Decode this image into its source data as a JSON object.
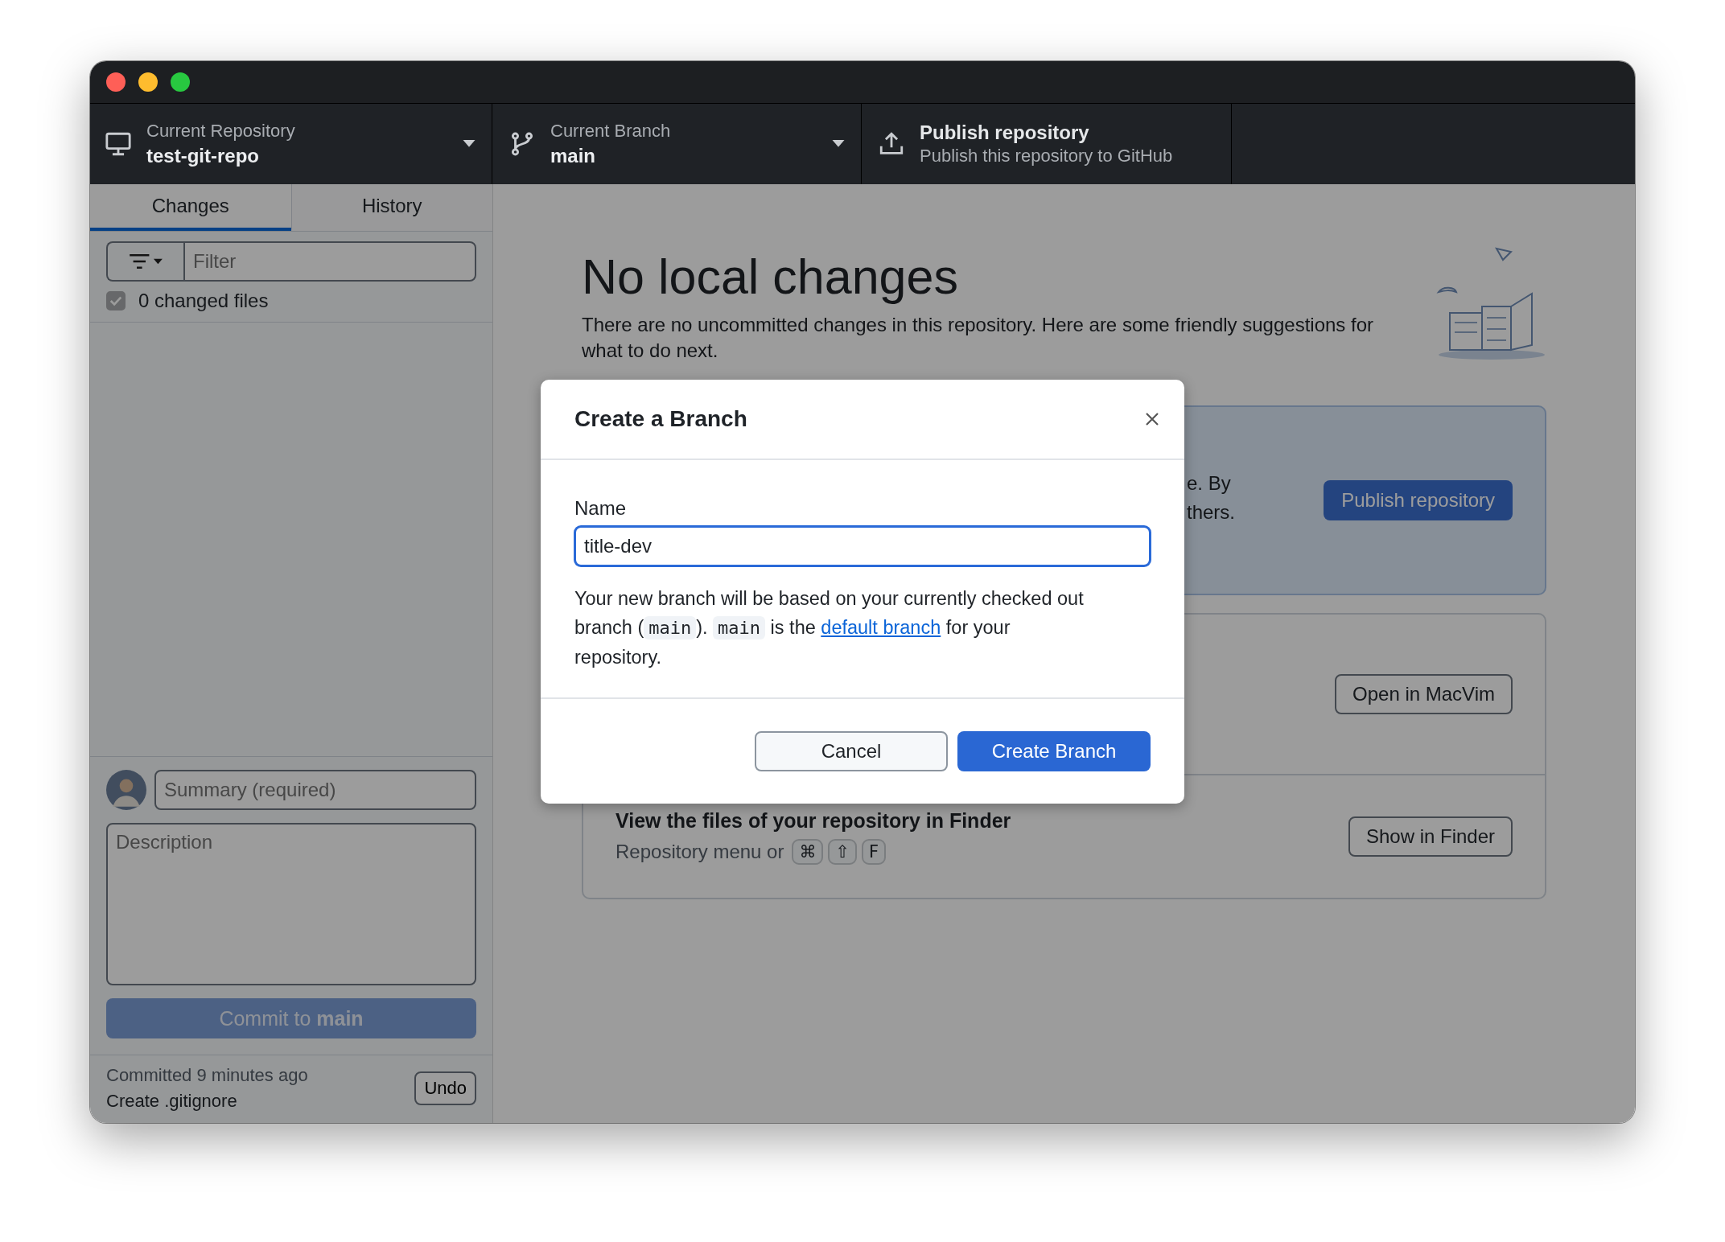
{
  "toolbar": [
    {
      "kind": "repository",
      "label": "Current Repository",
      "value": "test-git-repo",
      "dropdown": true
    },
    {
      "kind": "branch",
      "label": "Current Branch",
      "value": "main",
      "dropdown": true
    },
    {
      "kind": "publish",
      "label": "Publish repository",
      "value": "Publish this repository to GitHub",
      "dropdown": false
    }
  ],
  "sidebar": {
    "tabs": [
      {
        "label": "Changes",
        "selected": true
      },
      {
        "label": "History",
        "selected": false
      }
    ],
    "filter": {
      "placeholder": "Filter"
    },
    "changed_files": {
      "label": "0 changed files",
      "checked": true
    },
    "commit": {
      "summary_placeholder": "Summary (required)",
      "description_placeholder": "Description",
      "button": "Commit to **main**",
      "disabled": true
    },
    "last_commit": {
      "time": "Committed 9 minutes ago",
      "message": "Create .gitignore",
      "undo": "Undo"
    }
  },
  "main": {
    "heading": "No local changes",
    "description": "There are no uncommitted changes in this repository. Here are some friendly suggestions for what to do next.",
    "publish_card": {
      "text_fragments": [
        "e. By",
        "thers."
      ],
      "button": "Publish repository"
    },
    "editor_card": {
      "button": "Open in MacVim"
    },
    "finder_card": {
      "title": "View the files of your repository in Finder",
      "hint": "Repository menu or",
      "keys": [
        "⌘",
        "⇧",
        "F"
      ],
      "button": "Show in Finder"
    }
  },
  "dialog": {
    "title": "Create a Branch",
    "name_label": "Name",
    "name_value": "title-dev",
    "note": [
      {
        "kind": "text",
        "text": "Your new branch will be based on your currently checked out branch ("
      },
      {
        "kind": "code",
        "text": "main"
      },
      {
        "kind": "text",
        "text": "). "
      },
      {
        "kind": "code",
        "text": "main"
      },
      {
        "kind": "text",
        "text": " is the "
      },
      {
        "kind": "link",
        "text": "default branch"
      },
      {
        "kind": "text",
        "text": " for your repository."
      }
    ],
    "buttons": [
      {
        "label": "Cancel",
        "kind": "secondary"
      },
      {
        "label": "Create Branch",
        "kind": "primary"
      }
    ]
  }
}
